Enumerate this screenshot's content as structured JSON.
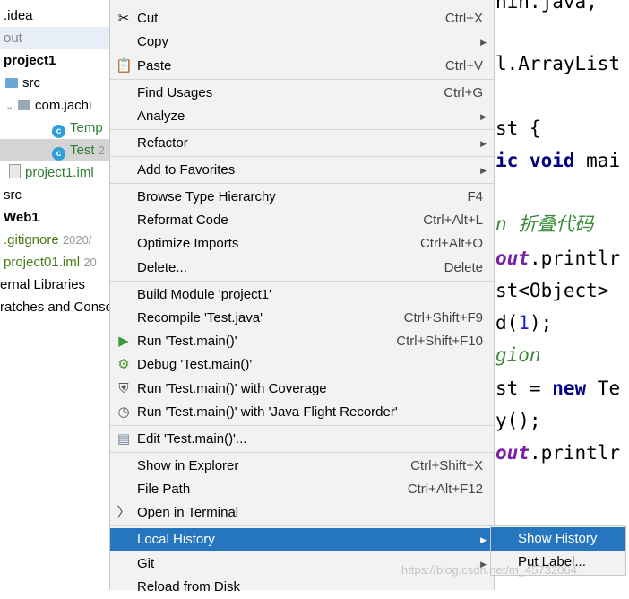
{
  "tree": [
    {
      "text": ".idea",
      "style": "normal"
    },
    {
      "text": "out",
      "style": "gray"
    },
    {
      "text": "project1",
      "style": "bold"
    },
    {
      "text": "src",
      "style": "normal"
    },
    {
      "text": "com.jachi",
      "style": "normal"
    },
    {
      "text": "Temp",
      "style": "green"
    },
    {
      "text": "Test",
      "suffix": "2",
      "style": "green"
    },
    {
      "text": "project1.iml",
      "style": "green"
    },
    {
      "text": "src",
      "style": "normal"
    },
    {
      "text": "Web1",
      "style": "bold"
    },
    {
      "text": ".gitignore",
      "suffix": "2020/",
      "style": "olive"
    },
    {
      "text": "project01.iml",
      "suffix": "20",
      "style": "olive"
    },
    {
      "text": "ernal Libraries",
      "style": "normal"
    },
    {
      "text": "ratches and Conso",
      "style": "normal"
    }
  ],
  "code": [
    "nin.java,",
    "",
    "l.ArrayList",
    "",
    "st {",
    "ic void mai",
    "",
    "n 折叠代码",
    "out.printlr",
    "st<Object>",
    "d(1);",
    "gion",
    "st = new Te",
    "y();",
    "out.printlr"
  ],
  "menu": {
    "cut": {
      "label": "Cut",
      "shortcut": "Ctrl+X"
    },
    "copy": {
      "label": "Copy"
    },
    "paste": {
      "label": "Paste",
      "shortcut": "Ctrl+V"
    },
    "find_usages": {
      "label": "Find Usages",
      "shortcut": "Ctrl+G"
    },
    "analyze": {
      "label": "Analyze"
    },
    "refactor": {
      "label": "Refactor"
    },
    "add_to_favorites": {
      "label": "Add to Favorites"
    },
    "browse_hierarchy": {
      "label": "Browse Type Hierarchy",
      "shortcut": "F4"
    },
    "reformat": {
      "label": "Reformat Code",
      "shortcut": "Ctrl+Alt+L"
    },
    "optimize_imports": {
      "label": "Optimize Imports",
      "shortcut": "Ctrl+Alt+O"
    },
    "delete": {
      "label": "Delete...",
      "shortcut": "Delete"
    },
    "build_module": {
      "label": "Build Module 'project1'"
    },
    "recompile": {
      "label": "Recompile 'Test.java'",
      "shortcut": "Ctrl+Shift+F9"
    },
    "run": {
      "label": "Run 'Test.main()'",
      "shortcut": "Ctrl+Shift+F10"
    },
    "debug": {
      "label": "Debug 'Test.main()'"
    },
    "run_coverage": {
      "label": "Run 'Test.main()' with Coverage"
    },
    "run_jfr": {
      "label": "Run 'Test.main()' with 'Java Flight Recorder'"
    },
    "edit_config": {
      "label": "Edit 'Test.main()'..."
    },
    "show_in_explorer": {
      "label": "Show in Explorer",
      "shortcut": "Ctrl+Shift+X"
    },
    "file_path": {
      "label": "File Path",
      "shortcut": "Ctrl+Alt+F12"
    },
    "open_terminal": {
      "label": "Open in Terminal"
    },
    "local_history": {
      "label": "Local History"
    },
    "git": {
      "label": "Git"
    },
    "reload": {
      "label": "Reload from Disk"
    }
  },
  "submenu": {
    "show_history": {
      "label": "Show History"
    },
    "put_label": {
      "label": "Put Label..."
    }
  },
  "watermark": "https://blog.csdn.net/m_45732064",
  "colors": {
    "highlight": "#2675bf",
    "menu_bg": "#f2f2f2"
  }
}
